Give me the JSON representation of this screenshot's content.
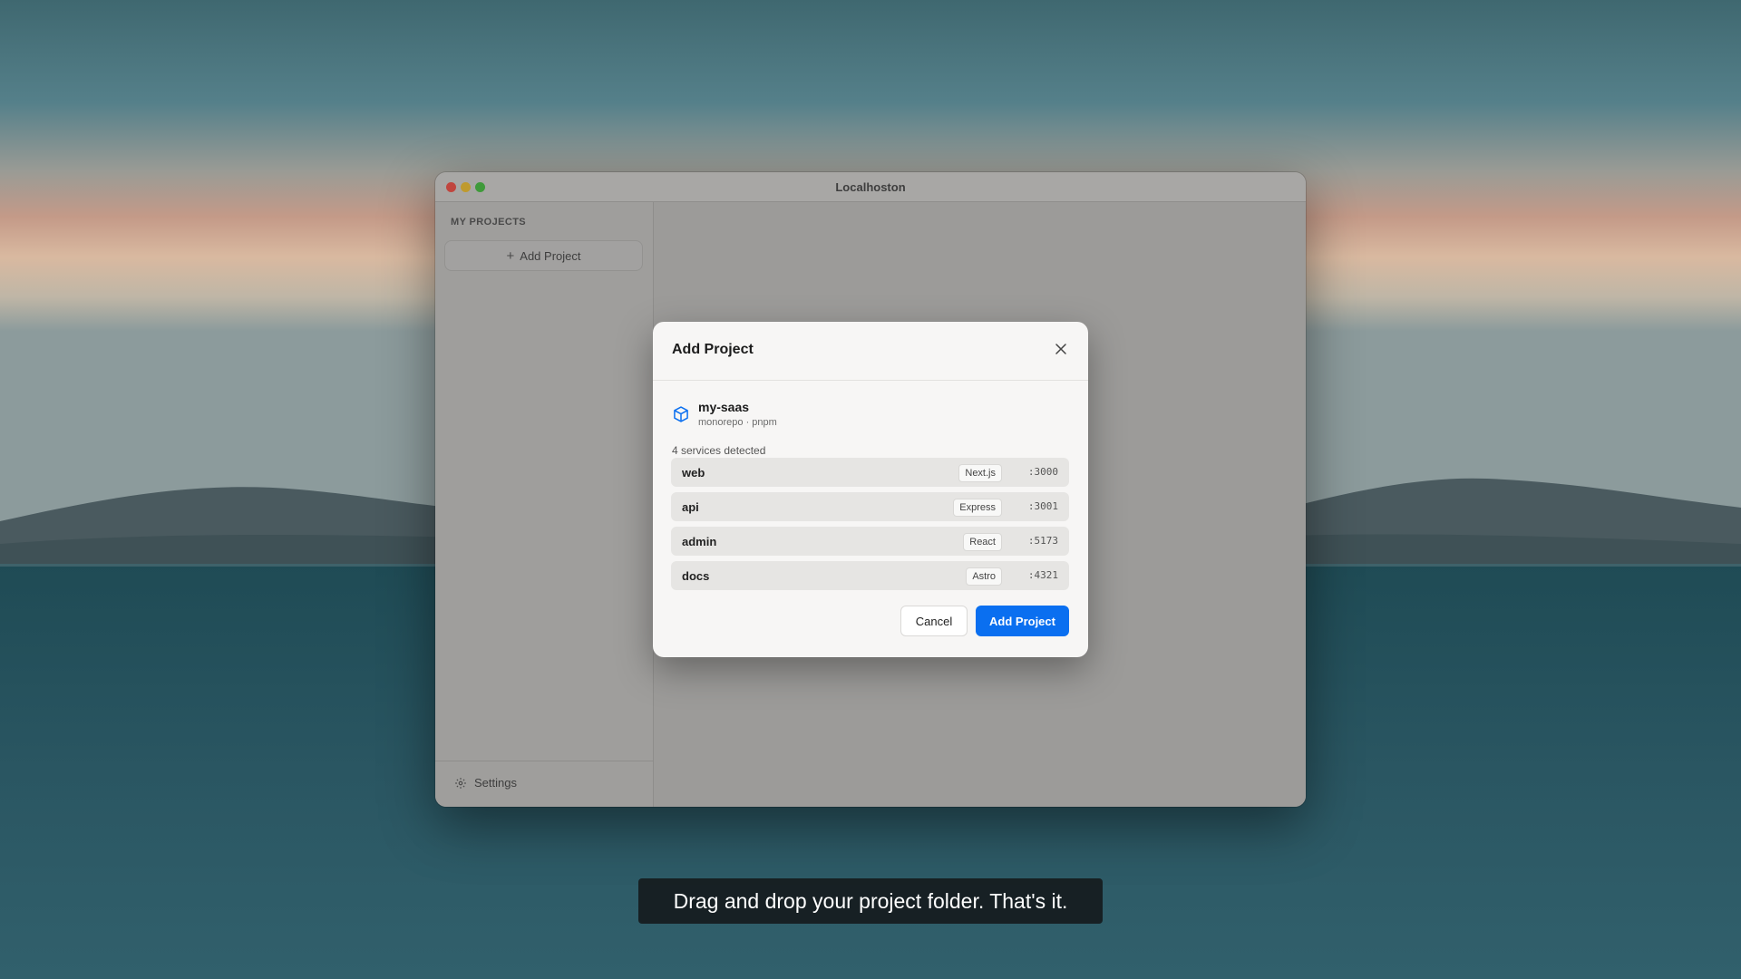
{
  "window": {
    "title": "Localhoston"
  },
  "sidebar": {
    "heading": "MY PROJECTS",
    "add_project_label": "Add Project",
    "settings_label": "Settings"
  },
  "modal": {
    "title": "Add Project",
    "project": {
      "name": "my-saas",
      "meta": "monorepo · pnpm",
      "icon": "package-icon"
    },
    "services_label": "4 services detected",
    "services": [
      {
        "name": "web",
        "framework": "Next.js",
        "port": ":3000"
      },
      {
        "name": "api",
        "framework": "Express",
        "port": ":3001"
      },
      {
        "name": "admin",
        "framework": "React",
        "port": ":5173"
      },
      {
        "name": "docs",
        "framework": "Astro",
        "port": ":4321"
      }
    ],
    "cancel_label": "Cancel",
    "confirm_label": "Add Project"
  },
  "caption": {
    "text": "Drag and drop your project folder. That's it."
  },
  "colors": {
    "accent": "#0a6ff0",
    "traffic_red": "#c0453e",
    "traffic_yellow": "#bf9a2e",
    "traffic_green": "#3f9a3a"
  }
}
